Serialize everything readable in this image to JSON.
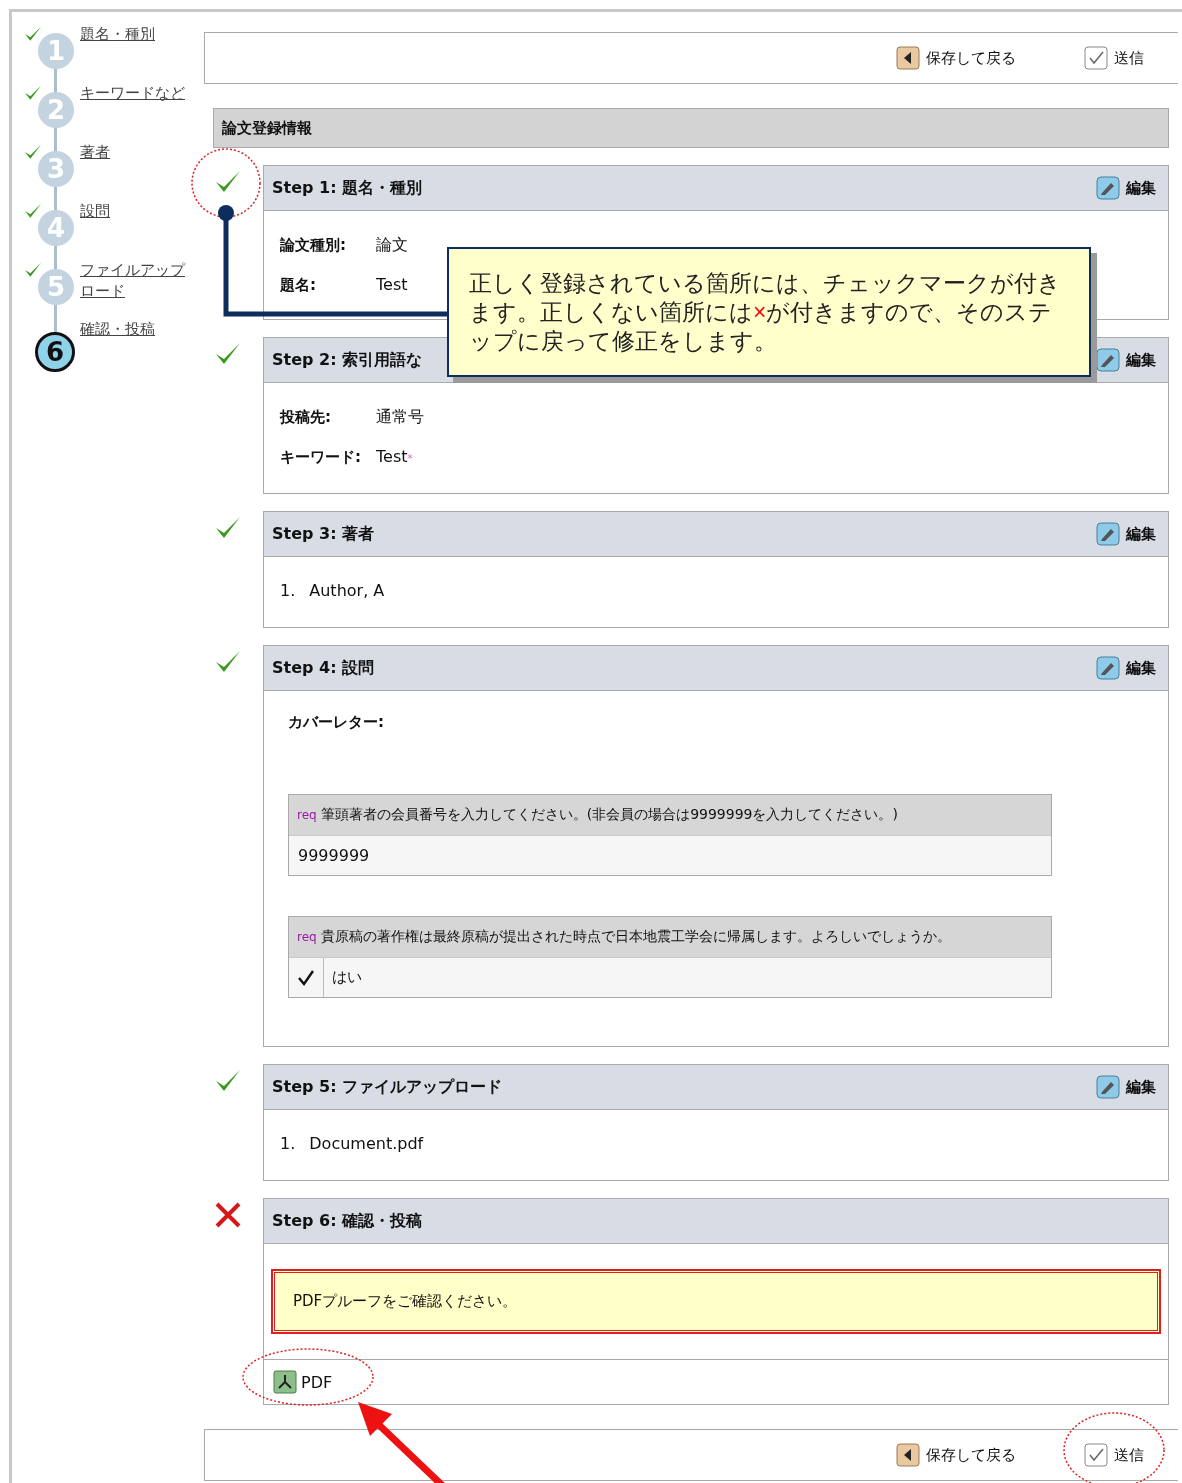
{
  "sidebar": {
    "steps": [
      {
        "number": "1",
        "label": "題名・種別",
        "done": true,
        "selected": false
      },
      {
        "number": "2",
        "label": "キーワードなど",
        "done": true,
        "selected": false
      },
      {
        "number": "3",
        "label": "著者",
        "done": true,
        "selected": false
      },
      {
        "number": "4",
        "label": "設問",
        "done": true,
        "selected": false
      },
      {
        "number": "5",
        "label": "ファイルアップロード",
        "done": true,
        "selected": false
      },
      {
        "number": "6",
        "label": "確認・投稿",
        "done": false,
        "selected": true
      }
    ]
  },
  "toolbar_top": {
    "buttons": [
      {
        "kind": "back",
        "label": "保存して戻る"
      },
      {
        "kind": "submit",
        "label": "送信"
      }
    ]
  },
  "section_title": "論文登録情報",
  "steps": [
    {
      "done": true,
      "title": "Step 1: 題名・種別",
      "edit": "編集",
      "kind": "fields",
      "fields": [
        {
          "label": "論文種別:",
          "value": "論文"
        },
        {
          "label": "題名:",
          "value": "Test"
        }
      ]
    },
    {
      "done": true,
      "title": "Step 2: 索引用語な",
      "edit": "編集",
      "kind": "fields",
      "fields": [
        {
          "label": "投稿先:",
          "value": "通常号"
        },
        {
          "label": "キーワード:",
          "value": "Test",
          "mark": "*"
        }
      ]
    },
    {
      "done": true,
      "title": "Step 3: 著者",
      "edit": "編集",
      "kind": "list",
      "items": [
        {
          "number": "1.",
          "text": "Author, A"
        }
      ]
    },
    {
      "done": true,
      "title": "Step 4: 設問",
      "edit": "編集",
      "kind": "questions",
      "intro": "カバーレター:",
      "questions": [
        {
          "tag": "req",
          "question": "筆頭著者の会員番号を入力してください。(非会員の場合は9999999を入力してください。)",
          "kind": "text",
          "answer": "9999999"
        },
        {
          "tag": "req",
          "question": "貴原稿の著作権は最終原稿が提出された時点で日本地震工学会に帰属します。よろしいでしょうか。",
          "kind": "check",
          "checked": true,
          "answer": "はい"
        }
      ]
    },
    {
      "done": true,
      "title": "Step 5: ファイルアップロード",
      "edit": "編集",
      "kind": "list",
      "items": [
        {
          "number": "1.",
          "text": "Document.pdf"
        }
      ]
    },
    {
      "done": false,
      "title": "Step 6: 確認・投稿",
      "kind": "alert",
      "alert": "PDFプルーフをご確認ください。",
      "link": "PDF"
    }
  ],
  "toolbar_bottom": {
    "buttons": [
      {
        "kind": "back",
        "label": "保存して戻る"
      },
      {
        "kind": "submit",
        "label": "送信"
      }
    ]
  },
  "callout": {
    "before": "正しく登録されている箇所には、チェックマークが付きます。正しくない箇所には",
    "mark": "×",
    "after": "が付きますので、そのステップに戻って修正をします。"
  }
}
